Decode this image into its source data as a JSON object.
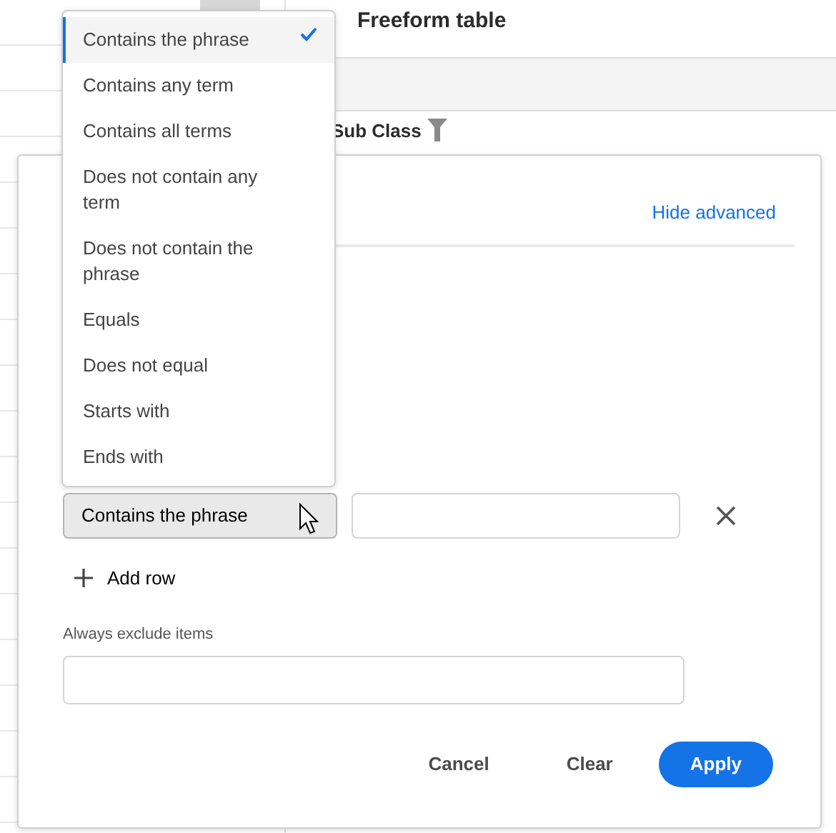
{
  "background": {
    "panel_title": "Freeform table",
    "column_header": "Sub Class"
  },
  "dialog": {
    "link": "Hide advanced",
    "condition": {
      "operator": "Contains the phrase"
    },
    "add_row": "Add row",
    "exclude_label": "Always exclude items",
    "buttons": [
      {
        "label": "Cancel",
        "kind": "quiet"
      },
      {
        "label": "Clear",
        "kind": "quiet"
      },
      {
        "label": "Apply",
        "kind": "primary"
      }
    ]
  },
  "dropdown": {
    "options": [
      {
        "label": "Contains the phrase",
        "selected": true
      },
      {
        "label": "Contains any term",
        "selected": false
      },
      {
        "label": "Contains all terms",
        "selected": false
      },
      {
        "label": "Does not contain any term",
        "selected": false
      },
      {
        "label": "Does not contain the phrase",
        "selected": false
      },
      {
        "label": "Equals",
        "selected": false
      },
      {
        "label": "Does not equal",
        "selected": false
      },
      {
        "label": "Starts with",
        "selected": false
      },
      {
        "label": "Ends with",
        "selected": false
      }
    ]
  }
}
